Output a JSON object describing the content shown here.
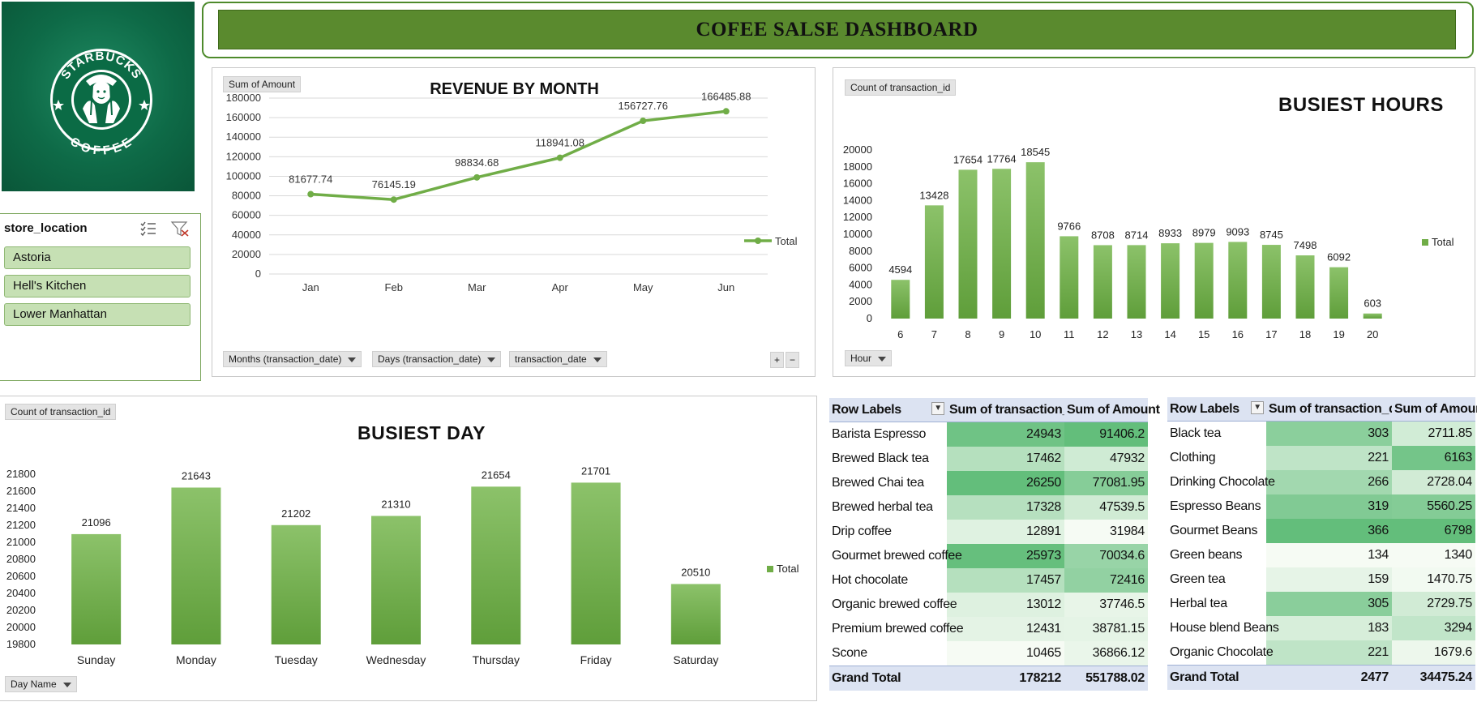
{
  "dashboard": {
    "title": "COFEE SALSE DASHBOARD",
    "logo_text_top": "STARBUCKS",
    "logo_text_bottom": "COFFEE"
  },
  "colors": {
    "accent_green": "#70ad47",
    "banner_green": "#5a8a2e",
    "logo_green": "#0e6a47",
    "slicer_fill": "#c6e0b4",
    "table_header": "#dce3f2"
  },
  "slicer": {
    "title": "store_location",
    "items": [
      "Astoria",
      "Hell's Kitchen",
      "Lower Manhattan"
    ],
    "icons": [
      "multi-select-icon",
      "clear-filter-icon"
    ]
  },
  "revenue": {
    "field_button": "Sum of Amount",
    "filters": [
      "Months (transaction_date)",
      "Days (transaction_date)",
      "transaction_date"
    ],
    "expand_buttons": [
      "+",
      "−"
    ]
  },
  "hours": {
    "field_button": "Count of transaction_id",
    "axis_button": "Hour"
  },
  "days": {
    "field_button": "Count of transaction_id",
    "axis_button": "Day Name"
  },
  "chart_data": [
    {
      "type": "line",
      "title": "REVENUE BY MONTH",
      "categories": [
        "Jan",
        "Feb",
        "Mar",
        "Apr",
        "May",
        "Jun"
      ],
      "series": [
        {
          "name": "Total",
          "values": [
            81677.74,
            76145.19,
            98834.68,
            118941.08,
            156727.76,
            166485.88
          ]
        }
      ],
      "ylim": [
        0,
        180000
      ],
      "yticks": [
        0,
        20000,
        40000,
        60000,
        80000,
        100000,
        120000,
        140000,
        160000,
        180000
      ],
      "grid": true,
      "legend": "right"
    },
    {
      "type": "bar",
      "title": "BUSIEST HOURS",
      "categories": [
        "6",
        "7",
        "8",
        "9",
        "10",
        "11",
        "12",
        "13",
        "14",
        "15",
        "16",
        "17",
        "18",
        "19",
        "20"
      ],
      "series": [
        {
          "name": "Total",
          "values": [
            4594,
            13428,
            17654,
            17764,
            18545,
            9766,
            8708,
            8714,
            8933,
            8979,
            9093,
            8745,
            7498,
            6092,
            603
          ]
        }
      ],
      "ylim": [
        0,
        20000
      ],
      "yticks": [
        0,
        2000,
        4000,
        6000,
        8000,
        10000,
        12000,
        14000,
        16000,
        18000,
        20000
      ],
      "grid": false,
      "legend": "right"
    },
    {
      "type": "bar",
      "title": "BUSIEST DAY",
      "categories": [
        "Sunday",
        "Monday",
        "Tuesday",
        "Wednesday",
        "Thursday",
        "Friday",
        "Saturday"
      ],
      "series": [
        {
          "name": "Total",
          "values": [
            21096,
            21643,
            21202,
            21310,
            21654,
            21701,
            20510
          ]
        }
      ],
      "ylim": [
        19800,
        21800
      ],
      "yticks": [
        19800,
        20000,
        20200,
        20400,
        20600,
        20800,
        21000,
        21200,
        21400,
        21600,
        21800
      ],
      "grid": false,
      "legend": "right"
    },
    {
      "type": "table",
      "columns": [
        "Row Labels",
        "Sum of transaction_qty",
        "Sum of Amount"
      ],
      "rows": [
        [
          "Barista Espresso",
          "24943",
          "91406.2"
        ],
        [
          "Brewed Black tea",
          "17462",
          "47932"
        ],
        [
          "Brewed Chai tea",
          "26250",
          "77081.95"
        ],
        [
          "Brewed herbal tea",
          "17328",
          "47539.5"
        ],
        [
          "Drip coffee",
          "12891",
          "31984"
        ],
        [
          "Gourmet brewed coffee",
          "25973",
          "70034.6"
        ],
        [
          "Hot chocolate",
          "17457",
          "72416"
        ],
        [
          "Organic brewed coffee",
          "13012",
          "37746.5"
        ],
        [
          "Premium brewed coffee",
          "12431",
          "38781.15"
        ],
        [
          "Scone",
          "10465",
          "36866.12"
        ]
      ],
      "total": [
        "Grand Total",
        "178212",
        "551788.02"
      ]
    },
    {
      "type": "table",
      "columns": [
        "Row Labels",
        "Sum of transaction_qty",
        "Sum of Amount"
      ],
      "rows": [
        [
          "Black tea",
          "303",
          "2711.85"
        ],
        [
          "Clothing",
          "221",
          "6163"
        ],
        [
          "Drinking Chocolate",
          "266",
          "2728.04"
        ],
        [
          "Espresso Beans",
          "319",
          "5560.25"
        ],
        [
          "Gourmet Beans",
          "366",
          "6798"
        ],
        [
          "Green beans",
          "134",
          "1340"
        ],
        [
          "Green tea",
          "159",
          "1470.75"
        ],
        [
          "Herbal tea",
          "305",
          "2729.75"
        ],
        [
          "House blend Beans",
          "183",
          "3294"
        ],
        [
          "Organic Chocolate",
          "221",
          "1679.6"
        ]
      ],
      "total": [
        "Grand Total",
        "2477",
        "34475.24"
      ]
    }
  ]
}
